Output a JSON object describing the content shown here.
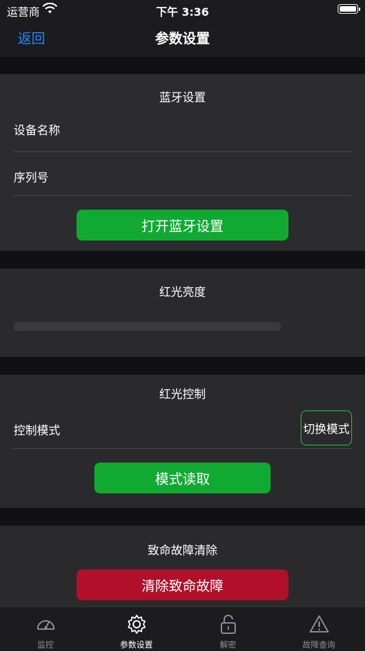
{
  "status_bar": {
    "carrier": "运营商",
    "time": "下午 3:36"
  },
  "nav": {
    "back_label": "返回",
    "title": "参数设置"
  },
  "bluetooth": {
    "title": "蓝牙设置",
    "device_name_label": "设备名称",
    "serial_label": "序列号",
    "open_button": "打开蓝牙设置"
  },
  "brightness": {
    "title": "红光亮度",
    "level": 0
  },
  "control": {
    "title": "红光控制",
    "mode_label": "控制模式",
    "switch_button": "切换模式",
    "read_button": "模式读取"
  },
  "fault": {
    "title": "致命故障清除",
    "clear_button": "清除致命故障"
  },
  "tabs": [
    {
      "label": "监控",
      "icon": "gauge-icon"
    },
    {
      "label": "参数设置",
      "icon": "gear-icon",
      "active": true
    },
    {
      "label": "解密",
      "icon": "unlock-icon"
    },
    {
      "label": "故障查询",
      "icon": "warning-icon"
    }
  ],
  "colors": {
    "accent_blue": "#1e88ff",
    "green": "#10aa33",
    "red": "#b0102a"
  }
}
